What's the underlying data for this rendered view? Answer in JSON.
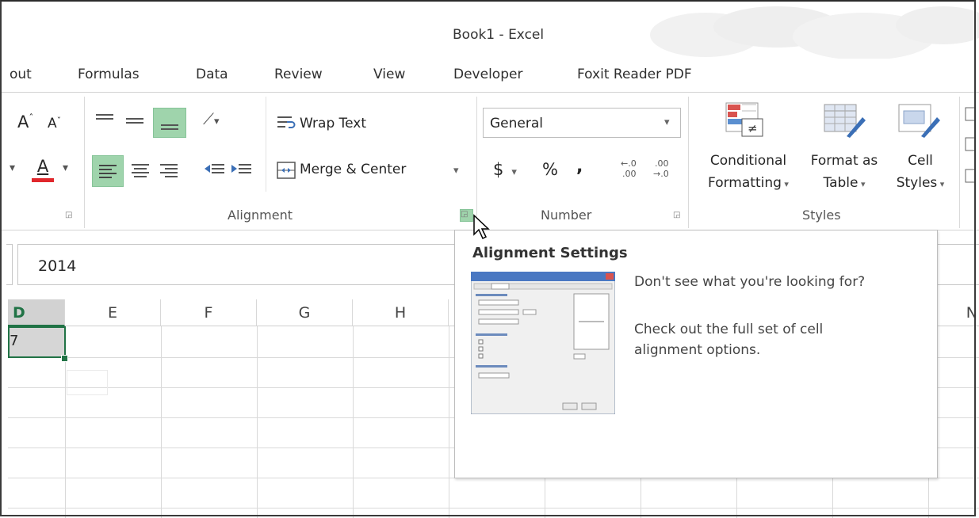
{
  "window": {
    "title": "Book1 - Excel"
  },
  "tabs": [
    "out",
    "Formulas",
    "Data",
    "Review",
    "View",
    "Developer",
    "Foxit Reader PDF"
  ],
  "ribbon": {
    "font_group": {
      "grow_font": "A",
      "shrink_font": "A",
      "font_color": "A"
    },
    "alignment_group": {
      "label": "Alignment",
      "wrap_text": "Wrap Text",
      "merge_center": "Merge & Center"
    },
    "number_group": {
      "label": "Number",
      "format_value": "General",
      "currency_symbol": "$",
      "percent_symbol": "%",
      "comma_symbol": ","
    },
    "styles_group": {
      "label": "Styles",
      "conditional_formatting": [
        "Conditional",
        "Formatting"
      ],
      "format_as_table": [
        "Format as",
        "Table"
      ],
      "cell_styles": [
        "Cell",
        "Styles"
      ]
    }
  },
  "formula_bar": {
    "value": "2014"
  },
  "grid": {
    "columns": [
      "D",
      "E",
      "F",
      "G",
      "H",
      "N"
    ],
    "active_cell_fragment": "7"
  },
  "tooltip": {
    "title": "Alignment Settings",
    "line1": "Don't see what you're looking for?",
    "line2": "Check out the full set of cell alignment options."
  },
  "colors": {
    "selection_green": "#217346",
    "highlight_green": "#9fd4ac",
    "accent_red": "#e0272c"
  }
}
